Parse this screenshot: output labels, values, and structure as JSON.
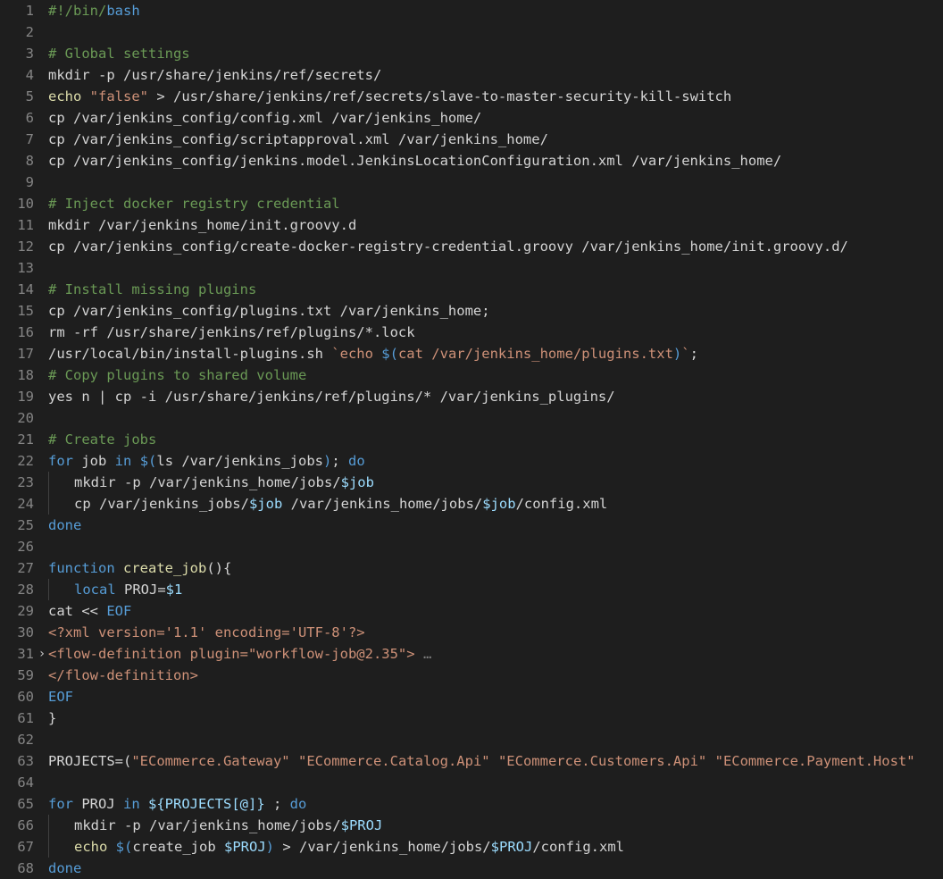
{
  "lines": [
    {
      "n": "1",
      "fold": "",
      "tokens": [
        [
          "tok-comment",
          "#!/bin/"
        ],
        [
          "tok-keyword",
          "bash"
        ]
      ]
    },
    {
      "n": "2",
      "fold": "",
      "tokens": [
        [
          "tok-default",
          ""
        ]
      ]
    },
    {
      "n": "3",
      "fold": "",
      "tokens": [
        [
          "tok-comment",
          "# Global settings"
        ]
      ]
    },
    {
      "n": "4",
      "fold": "",
      "tokens": [
        [
          "tok-default",
          "mkdir -p /usr/share/jenkins/ref/secrets/"
        ]
      ]
    },
    {
      "n": "5",
      "fold": "",
      "tokens": [
        [
          "tok-function",
          "echo"
        ],
        [
          "tok-default",
          " "
        ],
        [
          "tok-string",
          "\"false\""
        ],
        [
          "tok-default",
          " > /usr/share/jenkins/ref/secrets/slave-to-master-security-kill-switch"
        ]
      ]
    },
    {
      "n": "6",
      "fold": "",
      "tokens": [
        [
          "tok-default",
          "cp /var/jenkins_config/config.xml /var/jenkins_home/"
        ]
      ]
    },
    {
      "n": "7",
      "fold": "",
      "tokens": [
        [
          "tok-default",
          "cp /var/jenkins_config/scriptapproval.xml /var/jenkins_home/"
        ]
      ]
    },
    {
      "n": "8",
      "fold": "",
      "tokens": [
        [
          "tok-default",
          "cp /var/jenkins_config/jenkins.model.JenkinsLocationConfiguration.xml /var/jenkins_home/"
        ]
      ]
    },
    {
      "n": "9",
      "fold": "",
      "tokens": [
        [
          "tok-default",
          ""
        ]
      ]
    },
    {
      "n": "10",
      "fold": "",
      "tokens": [
        [
          "tok-comment",
          "# Inject docker registry credential"
        ]
      ]
    },
    {
      "n": "11",
      "fold": "",
      "tokens": [
        [
          "tok-default",
          "mkdir /var/jenkins_home/init.groovy.d"
        ]
      ]
    },
    {
      "n": "12",
      "fold": "",
      "tokens": [
        [
          "tok-default",
          "cp /var/jenkins_config/create-docker-registry-credential.groovy /var/jenkins_home/init.groovy.d/"
        ]
      ]
    },
    {
      "n": "13",
      "fold": "",
      "tokens": [
        [
          "tok-default",
          ""
        ]
      ]
    },
    {
      "n": "14",
      "fold": "",
      "tokens": [
        [
          "tok-comment",
          "# Install missing plugins"
        ]
      ]
    },
    {
      "n": "15",
      "fold": "",
      "tokens": [
        [
          "tok-default",
          "cp /var/jenkins_config/plugins.txt /var/jenkins_home;"
        ]
      ]
    },
    {
      "n": "16",
      "fold": "",
      "tokens": [
        [
          "tok-default",
          "rm -rf /usr/share/jenkins/ref/plugins/*.lock"
        ]
      ]
    },
    {
      "n": "17",
      "fold": "",
      "tokens": [
        [
          "tok-default",
          "/usr/local/bin/install-plugins.sh "
        ],
        [
          "tok-string",
          "`echo "
        ],
        [
          "tok-keyword",
          "$("
        ],
        [
          "tok-string",
          "cat /var/jenkins_home/plugins.txt"
        ],
        [
          "tok-keyword",
          ")"
        ],
        [
          "tok-string",
          "`"
        ],
        [
          "tok-default",
          ";"
        ]
      ]
    },
    {
      "n": "18",
      "fold": "",
      "tokens": [
        [
          "tok-comment",
          "# Copy plugins to shared volume"
        ]
      ]
    },
    {
      "n": "19",
      "fold": "",
      "tokens": [
        [
          "tok-default",
          "yes n | cp -i /usr/share/jenkins/ref/plugins/* /var/jenkins_plugins/"
        ]
      ]
    },
    {
      "n": "20",
      "fold": "",
      "tokens": [
        [
          "tok-default",
          ""
        ]
      ]
    },
    {
      "n": "21",
      "fold": "",
      "tokens": [
        [
          "tok-comment",
          "# Create jobs"
        ]
      ]
    },
    {
      "n": "22",
      "fold": "",
      "tokens": [
        [
          "tok-keyword",
          "for"
        ],
        [
          "tok-default",
          " job "
        ],
        [
          "tok-keyword",
          "in"
        ],
        [
          "tok-default",
          " "
        ],
        [
          "tok-keyword",
          "$("
        ],
        [
          "tok-default",
          "ls /var/jenkins_jobs"
        ],
        [
          "tok-keyword",
          ")"
        ],
        [
          "tok-default",
          "; "
        ],
        [
          "tok-keyword",
          "do"
        ]
      ]
    },
    {
      "n": "23",
      "fold": "",
      "guide": true,
      "tokens": [
        [
          "tok-default",
          "   mkdir -p /var/jenkins_home/jobs/"
        ],
        [
          "tok-variable",
          "$job"
        ]
      ]
    },
    {
      "n": "24",
      "fold": "",
      "guide": true,
      "tokens": [
        [
          "tok-default",
          "   cp /var/jenkins_jobs/"
        ],
        [
          "tok-variable",
          "$job"
        ],
        [
          "tok-default",
          " /var/jenkins_home/jobs/"
        ],
        [
          "tok-variable",
          "$job"
        ],
        [
          "tok-default",
          "/config.xml"
        ]
      ]
    },
    {
      "n": "25",
      "fold": "",
      "tokens": [
        [
          "tok-keyword",
          "done"
        ]
      ]
    },
    {
      "n": "26",
      "fold": "",
      "tokens": [
        [
          "tok-default",
          ""
        ]
      ]
    },
    {
      "n": "27",
      "fold": "",
      "tokens": [
        [
          "tok-keyword",
          "function"
        ],
        [
          "tok-default",
          " "
        ],
        [
          "tok-function",
          "create_job"
        ],
        [
          "tok-default",
          "(){"
        ]
      ]
    },
    {
      "n": "28",
      "fold": "",
      "guide": true,
      "tokens": [
        [
          "tok-default",
          "   "
        ],
        [
          "tok-keyword",
          "local"
        ],
        [
          "tok-default",
          " PROJ="
        ],
        [
          "tok-variable",
          "$1"
        ]
      ]
    },
    {
      "n": "29",
      "fold": "",
      "tokens": [
        [
          "tok-default",
          "cat << "
        ],
        [
          "tok-keyword",
          "EOF"
        ]
      ]
    },
    {
      "n": "30",
      "fold": "",
      "tokens": [
        [
          "tok-string",
          "<?xml version='1.1' encoding='UTF-8'?>"
        ]
      ]
    },
    {
      "n": "31",
      "fold": "›",
      "tokens": [
        [
          "tok-string",
          "<flow-definition plugin=\"workflow-job@2.35\">"
        ],
        [
          "tok-fold-dots",
          " …"
        ]
      ]
    },
    {
      "n": "59",
      "fold": "",
      "tokens": [
        [
          "tok-string",
          "</flow-definition>"
        ]
      ]
    },
    {
      "n": "60",
      "fold": "",
      "tokens": [
        [
          "tok-keyword",
          "EOF"
        ]
      ]
    },
    {
      "n": "61",
      "fold": "",
      "tokens": [
        [
          "tok-default",
          "}"
        ]
      ]
    },
    {
      "n": "62",
      "fold": "",
      "tokens": [
        [
          "tok-default",
          ""
        ]
      ]
    },
    {
      "n": "63",
      "fold": "",
      "tokens": [
        [
          "tok-default",
          "PROJECTS=("
        ],
        [
          "tok-string",
          "\"ECommerce.Gateway\""
        ],
        [
          "tok-default",
          " "
        ],
        [
          "tok-string",
          "\"ECommerce.Catalog.Api\""
        ],
        [
          "tok-default",
          " "
        ],
        [
          "tok-string",
          "\"ECommerce.Customers.Api\""
        ],
        [
          "tok-default",
          " "
        ],
        [
          "tok-string",
          "\"ECommerce.Payment.Host\""
        ]
      ]
    },
    {
      "n": "64",
      "fold": "",
      "tokens": [
        [
          "tok-default",
          ""
        ]
      ]
    },
    {
      "n": "65",
      "fold": "",
      "tokens": [
        [
          "tok-keyword",
          "for"
        ],
        [
          "tok-default",
          " PROJ "
        ],
        [
          "tok-keyword",
          "in"
        ],
        [
          "tok-default",
          " "
        ],
        [
          "tok-variable",
          "${PROJECTS[@]}"
        ],
        [
          "tok-default",
          " ; "
        ],
        [
          "tok-keyword",
          "do"
        ]
      ]
    },
    {
      "n": "66",
      "fold": "",
      "guide": true,
      "tokens": [
        [
          "tok-default",
          "   mkdir -p /var/jenkins_home/jobs/"
        ],
        [
          "tok-variable",
          "$PROJ"
        ]
      ]
    },
    {
      "n": "67",
      "fold": "",
      "guide": true,
      "tokens": [
        [
          "tok-default",
          "   "
        ],
        [
          "tok-function",
          "echo"
        ],
        [
          "tok-default",
          " "
        ],
        [
          "tok-keyword",
          "$("
        ],
        [
          "tok-default",
          "create_job "
        ],
        [
          "tok-variable",
          "$PROJ"
        ],
        [
          "tok-keyword",
          ")"
        ],
        [
          "tok-default",
          " > /var/jenkins_home/jobs/"
        ],
        [
          "tok-variable",
          "$PROJ"
        ],
        [
          "tok-default",
          "/config.xml"
        ]
      ]
    },
    {
      "n": "68",
      "fold": "",
      "tokens": [
        [
          "tok-keyword",
          "done"
        ]
      ]
    }
  ]
}
